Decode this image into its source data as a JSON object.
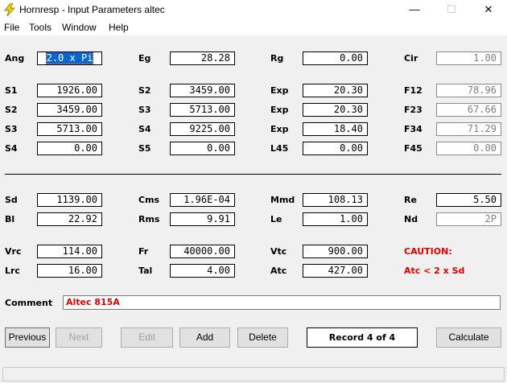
{
  "window": {
    "title": "Hornresp - Input Parameters   altec",
    "minimize": "—",
    "maximize": "☐",
    "close": "✕"
  },
  "menu": [
    "File",
    "Tools",
    "Window",
    "Help"
  ],
  "fields": {
    "Ang": "2.0 x Pi",
    "Eg": "28.28",
    "Rg": "0.00",
    "Cir": "1.00",
    "S1": "1926.00",
    "S2a": "3459.00",
    "Exp1": "20.30",
    "F12": "78.96",
    "S2": "3459.00",
    "S3a": "5713.00",
    "Exp2": "20.30",
    "F23": "67.66",
    "S3": "5713.00",
    "S4a": "9225.00",
    "Exp3": "18.40",
    "F34": "71.29",
    "S4": "0.00",
    "S5": "0.00",
    "L45": "0.00",
    "F45": "0.00",
    "Sd": "1139.00",
    "Cms": "1.96E-04",
    "Mmd": "108.13",
    "Re": "5.50",
    "Bl": "22.92",
    "Rms": "9.91",
    "Le": "1.00",
    "Nd": "2P",
    "Vrc": "114.00",
    "Fr": "40000.00",
    "Vtc": "900.00",
    "Lrc": "16.00",
    "Tal": "4.00",
    "Atc": "427.00"
  },
  "labels": {
    "Ang": "Ang",
    "Eg": "Eg",
    "Rg": "Rg",
    "Cir": "Cir",
    "S1": "S1",
    "S2": "S2",
    "Exp": "Exp",
    "F12": "F12",
    "S3": "S3",
    "F23": "F23",
    "S4": "S4",
    "F34": "F34",
    "S5": "S5",
    "L45": "L45",
    "F45": "F45",
    "Sd": "Sd",
    "Cms": "Cms",
    "Mmd": "Mmd",
    "Re": "Re",
    "Bl": "Bl",
    "Rms": "Rms",
    "Le": "Le",
    "Nd": "Nd",
    "Vrc": "Vrc",
    "Fr": "Fr",
    "Vtc": "Vtc",
    "Lrc": "Lrc",
    "Tal": "Tal",
    "Atc": "Atc",
    "Comment": "Comment"
  },
  "caution": {
    "title": "CAUTION:",
    "message": "Atc < 2 x Sd"
  },
  "comment": "Altec 815A",
  "buttons": {
    "previous": "Previous",
    "next": "Next",
    "edit": "Edit",
    "add": "Add",
    "delete": "Delete",
    "calculate": "Calculate"
  },
  "record": "Record 4 of 4",
  "colors": {
    "caution": "#e00000",
    "selection": "#0a64d2",
    "readonly_text": "#808080"
  }
}
